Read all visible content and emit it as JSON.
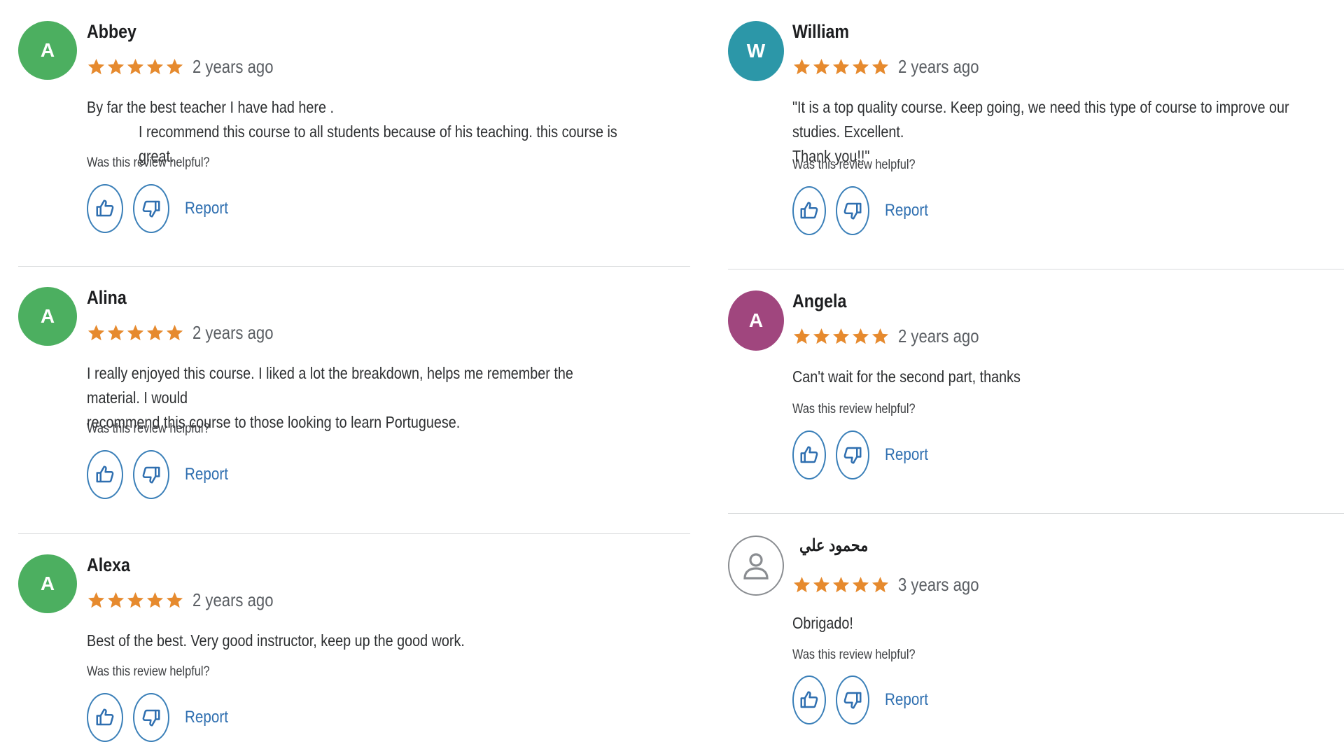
{
  "helpful_prompt": "Was this review helpful?",
  "report_label": "Report",
  "star_color": "#e68a2e",
  "icons": {
    "thumbs_up": "thumbs-up-icon",
    "thumbs_down": "thumbs-down-icon",
    "user": "user-icon"
  },
  "reviews": [
    {
      "initial": "A",
      "avatar_color": "#4caf60",
      "name": "Abbey",
      "rating": 5,
      "time": "2 years ago",
      "text_line1": "By far the best teacher I have had here .",
      "text_line2": "I recommend this course to all students because of his teaching. this course is great."
    },
    {
      "initial": "A",
      "avatar_color": "#4caf60",
      "name": "Alina",
      "rating": 5,
      "time": "2 years ago",
      "text_line1": "I really enjoyed this course. I liked a lot the breakdown, helps me remember the material. I would",
      "text_line2": "recommend this course to those looking to learn Portuguese."
    },
    {
      "initial": "A",
      "avatar_color": "#4caf60",
      "name": "Alexa",
      "rating": 5,
      "time": "2 years ago",
      "text_line1": "Best of the best. Very good instructor, keep up the good work."
    },
    {
      "initial": "W",
      "avatar_color": "#2c97a8",
      "name": "William",
      "rating": 5,
      "time": "2 years ago",
      "text_line1": "\"It is a top quality course. Keep going, we need this type of course to improve our studies. Excellent.",
      "text_line2": "Thank you!!\""
    },
    {
      "initial": "A",
      "avatar_color": "#a0467e",
      "name": "Angela",
      "rating": 5,
      "time": "2 years ago",
      "text_line1": "Can't wait for the second part, thanks"
    },
    {
      "initial": "",
      "avatar_color": "#ffffff",
      "name": "محمود علي",
      "rating": 5,
      "time": "3 years ago",
      "text_line1": "Obrigado!"
    }
  ]
}
